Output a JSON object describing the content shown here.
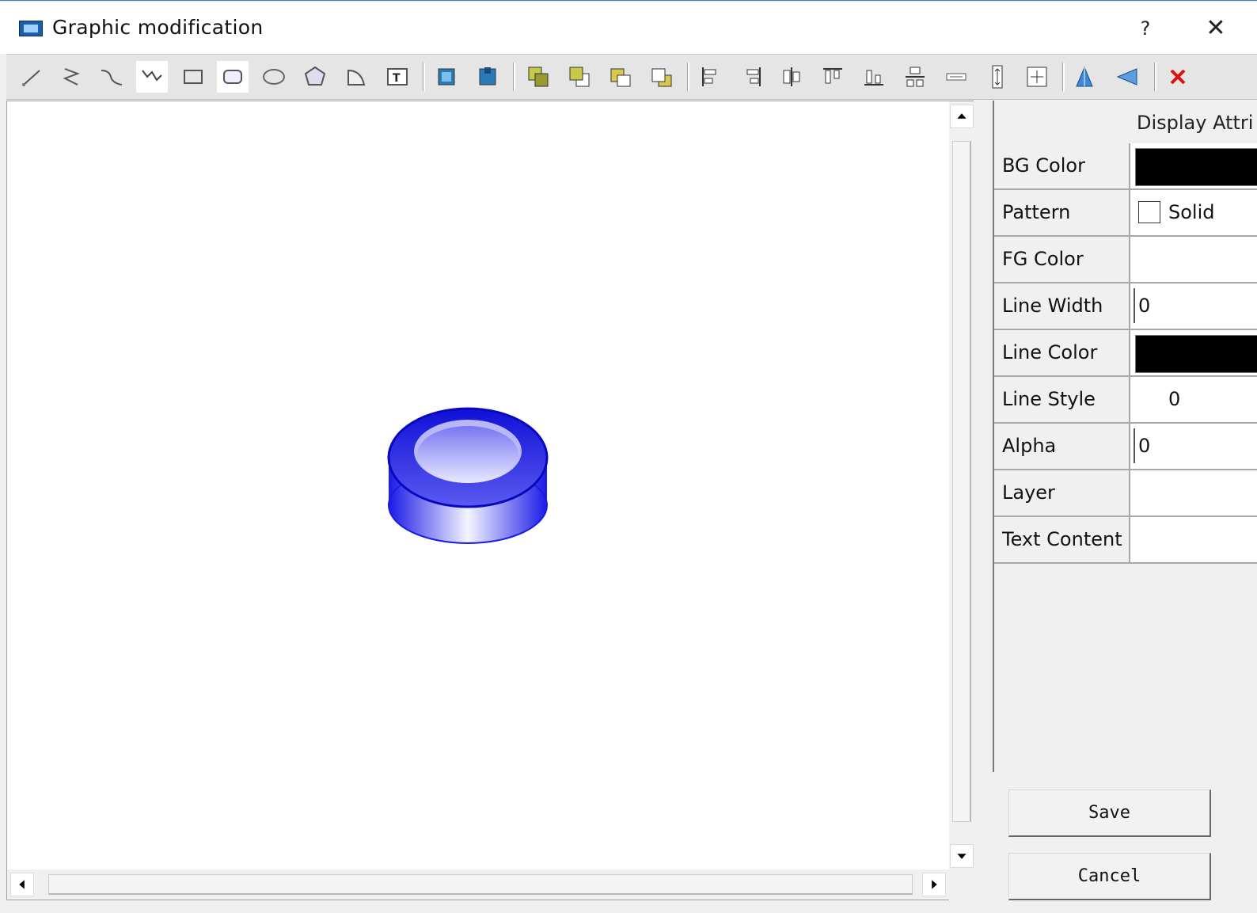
{
  "window": {
    "title": "Graphic modification",
    "help_label": "?",
    "close_label": "✕"
  },
  "toolbar": {
    "tools": [
      {
        "name": "line-tool-icon"
      },
      {
        "name": "polyline-tool-icon"
      },
      {
        "name": "curve-tool-icon"
      },
      {
        "name": "zigzag-tool-icon"
      },
      {
        "name": "rectangle-tool-icon"
      },
      {
        "name": "rounded-rect-tool-icon"
      },
      {
        "name": "ellipse-tool-icon"
      },
      {
        "name": "polygon-tool-icon"
      },
      {
        "name": "arc-tool-icon"
      },
      {
        "name": "text-tool-icon"
      },
      {
        "name": "image-tool-icon"
      },
      {
        "name": "picture-tool-icon"
      },
      {
        "name": "bring-front-icon"
      },
      {
        "name": "send-back-icon"
      },
      {
        "name": "bring-forward-icon"
      },
      {
        "name": "send-backward-icon"
      },
      {
        "name": "align-left-icon"
      },
      {
        "name": "align-right-icon"
      },
      {
        "name": "align-center-horizontal-icon"
      },
      {
        "name": "align-top-icon"
      },
      {
        "name": "align-bottom-icon"
      },
      {
        "name": "align-center-vertical-icon"
      },
      {
        "name": "same-width-icon"
      },
      {
        "name": "same-height-icon"
      },
      {
        "name": "same-size-icon"
      },
      {
        "name": "flip-vertical-icon"
      },
      {
        "name": "flip-horizontal-icon"
      },
      {
        "name": "delete-icon"
      }
    ]
  },
  "panel": {
    "header": "Display Attri",
    "rows": [
      {
        "label": "BG Color",
        "value": "",
        "color": "#000000"
      },
      {
        "label": "Pattern",
        "value": "Solid"
      },
      {
        "label": "FG Color",
        "value": ""
      },
      {
        "label": "Line Width",
        "value": "0"
      },
      {
        "label": "Line Color",
        "value": "",
        "color": "#000000"
      },
      {
        "label": "Line Style",
        "value": "0"
      },
      {
        "label": "Alpha",
        "value": "0"
      },
      {
        "label": "Layer",
        "value": ""
      },
      {
        "label": "Text Content",
        "value": ""
      }
    ]
  },
  "buttons": {
    "save": "Save",
    "cancel": "Cancel"
  },
  "canvas": {
    "shape": "blue-cylinder-button",
    "shape_color": "#2424e0"
  }
}
